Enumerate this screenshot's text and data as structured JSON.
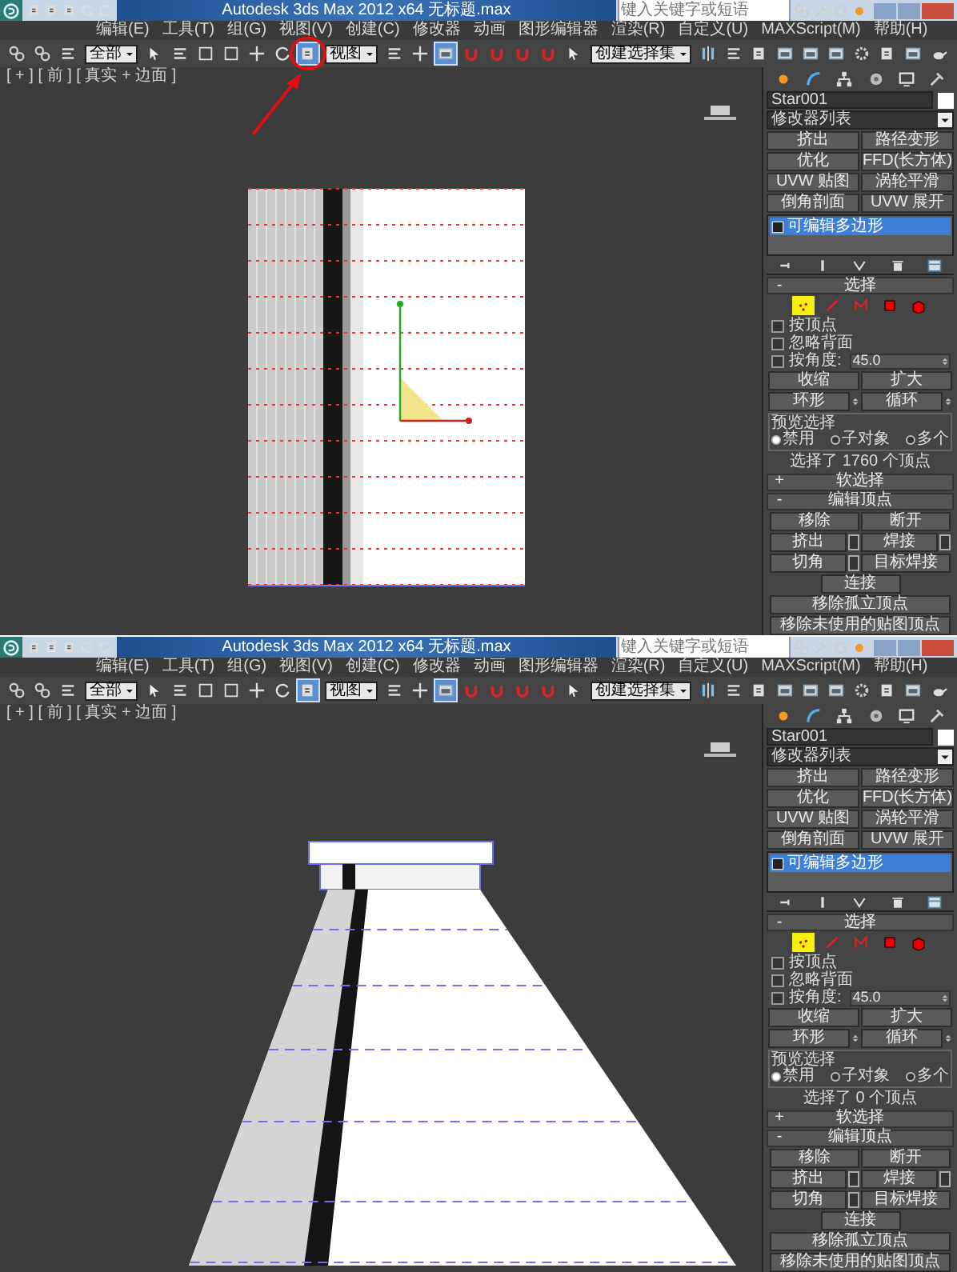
{
  "screenshots": [
    {
      "title_bar": {
        "title": "Autodesk 3ds Max  2012 x64    无标题.max",
        "search_placeholder": "键入关键字或短语"
      },
      "menu": [
        "编辑(E)",
        "工具(T)",
        "组(G)",
        "视图(V)",
        "创建(C)",
        "修改器",
        "动画",
        "图形编辑器",
        "渲染(R)",
        "自定义(U)",
        "MAXScript(M)",
        "帮助(H)"
      ],
      "toolbar": [
        {
          "kind": "button",
          "selected": false,
          "callout": false
        },
        {
          "kind": "button",
          "selected": false,
          "callout": false
        },
        {
          "kind": "button",
          "selected": false,
          "callout": false
        },
        {
          "kind": "dropdown",
          "value": "全部"
        },
        {
          "kind": "button",
          "selected": false,
          "callout": false
        },
        {
          "kind": "button",
          "selected": false,
          "callout": false
        },
        {
          "kind": "button",
          "selected": false,
          "callout": false
        },
        {
          "kind": "button",
          "selected": false,
          "callout": false
        },
        {
          "kind": "button",
          "selected": false,
          "callout": false
        },
        {
          "kind": "button",
          "selected": false,
          "callout": false
        },
        {
          "kind": "button",
          "selected": true,
          "callout": true
        },
        {
          "kind": "dropdown",
          "value": "视图"
        },
        {
          "kind": "button",
          "selected": false,
          "callout": false
        },
        {
          "kind": "button",
          "selected": false,
          "callout": false
        },
        {
          "kind": "button",
          "selected": true,
          "callout": false
        },
        {
          "kind": "button",
          "selected": false,
          "callout": false
        },
        {
          "kind": "button",
          "selected": false,
          "callout": false
        },
        {
          "kind": "button",
          "selected": false,
          "callout": false
        },
        {
          "kind": "button",
          "selected": false,
          "callout": false
        },
        {
          "kind": "button",
          "selected": false,
          "callout": false
        },
        {
          "kind": "dropdown",
          "value": "创建选择集"
        },
        {
          "kind": "button",
          "selected": false,
          "callout": false
        },
        {
          "kind": "button",
          "selected": false,
          "callout": false
        },
        {
          "kind": "button",
          "selected": false,
          "callout": false
        },
        {
          "kind": "button",
          "selected": false,
          "callout": false
        },
        {
          "kind": "button",
          "selected": false,
          "callout": false
        },
        {
          "kind": "button",
          "selected": false,
          "callout": false
        },
        {
          "kind": "button",
          "selected": false,
          "callout": false
        },
        {
          "kind": "button",
          "selected": false,
          "callout": false
        },
        {
          "kind": "button",
          "selected": false,
          "callout": false
        },
        {
          "kind": "button",
          "selected": false,
          "callout": false
        }
      ],
      "viewport": {
        "label": "[ + ] [ 前 ] [ 真实 + 边面 ]",
        "kind": "front"
      },
      "panel": {
        "object_name": "Star001",
        "modifier_list": "修改器列表",
        "modifier_buttons": [
          "挤出",
          "路径变形",
          "优化",
          "FFD(长方体)",
          "UVW 贴图",
          "涡轮平滑",
          "倒角剖面",
          "UVW 展开"
        ],
        "stack": [
          {
            "label": "可编辑多边形",
            "selected": true
          }
        ],
        "selection": {
          "sign": "-",
          "title": "选择",
          "subobjects": [
            {
              "selected": true
            },
            {
              "selected": false
            },
            {
              "selected": false
            },
            {
              "selected": false
            },
            {
              "selected": false
            }
          ],
          "checkboxes": [
            {
              "kind": "plain",
              "label": "按顶点",
              "checked": false
            },
            {
              "kind": "plain",
              "label": "忽略背面",
              "checked": false
            },
            {
              "kind": "angle",
              "label": "按角度:",
              "checked": false,
              "value": "45.0"
            }
          ],
          "buttons": [
            {
              "kind": "plain",
              "label": "收缩"
            },
            {
              "kind": "plain",
              "label": "扩大"
            },
            {
              "kind": "spinner",
              "label": "环形"
            },
            {
              "kind": "spinner",
              "label": "循环"
            }
          ],
          "preview": {
            "title": "预览选择",
            "options": [
              {
                "label": "禁用",
                "selected": true
              },
              {
                "label": "子对象",
                "selected": false
              },
              {
                "label": "多个",
                "selected": false
              }
            ]
          },
          "status": "选择了 1760 个顶点"
        },
        "soft_selection": {
          "sign": "+",
          "title": "软选择"
        },
        "edit_vertices": {
          "sign": "-",
          "title": "编辑顶点",
          "buttons": [
            {
              "kind": "half",
              "label": "移除"
            },
            {
              "kind": "half",
              "label": "断开"
            },
            {
              "kind": "settings",
              "label": "挤出"
            },
            {
              "kind": "settings",
              "label": "焊接"
            },
            {
              "kind": "settings",
              "label": "切角"
            },
            {
              "kind": "half",
              "label": "目标焊接"
            },
            {
              "kind": "center",
              "label": "连接"
            },
            {
              "kind": "full",
              "label": "移除孤立顶点"
            },
            {
              "kind": "full",
              "label": "移除未使用的贴图顶点"
            }
          ]
        }
      }
    },
    {
      "title_bar": {
        "title": "Autodesk 3ds Max  2012 x64    无标题.max",
        "search_placeholder": "键入关键字或短语"
      },
      "menu": [
        "编辑(E)",
        "工具(T)",
        "组(G)",
        "视图(V)",
        "创建(C)",
        "修改器",
        "动画",
        "图形编辑器",
        "渲染(R)",
        "自定义(U)",
        "MAXScript(M)",
        "帮助(H)"
      ],
      "toolbar": [
        {
          "kind": "button",
          "selected": false,
          "callout": false
        },
        {
          "kind": "button",
          "selected": false,
          "callout": false
        },
        {
          "kind": "button",
          "selected": false,
          "callout": false
        },
        {
          "kind": "dropdown",
          "value": "全部"
        },
        {
          "kind": "button",
          "selected": false,
          "callout": false
        },
        {
          "kind": "button",
          "selected": false,
          "callout": false
        },
        {
          "kind": "button",
          "selected": false,
          "callout": false
        },
        {
          "kind": "button",
          "selected": false,
          "callout": false
        },
        {
          "kind": "button",
          "selected": false,
          "callout": false
        },
        {
          "kind": "button",
          "selected": false,
          "callout": false
        },
        {
          "kind": "button",
          "selected": true,
          "callout": false
        },
        {
          "kind": "dropdown",
          "value": "视图"
        },
        {
          "kind": "button",
          "selected": false,
          "callout": false
        },
        {
          "kind": "button",
          "selected": false,
          "callout": false
        },
        {
          "kind": "button",
          "selected": true,
          "callout": false
        },
        {
          "kind": "button",
          "selected": false,
          "callout": false
        },
        {
          "kind": "button",
          "selected": false,
          "callout": false
        },
        {
          "kind": "button",
          "selected": false,
          "callout": false
        },
        {
          "kind": "button",
          "selected": false,
          "callout": false
        },
        {
          "kind": "button",
          "selected": false,
          "callout": false
        },
        {
          "kind": "dropdown",
          "value": "创建选择集"
        },
        {
          "kind": "button",
          "selected": false,
          "callout": false
        },
        {
          "kind": "button",
          "selected": false,
          "callout": false
        },
        {
          "kind": "button",
          "selected": false,
          "callout": false
        },
        {
          "kind": "button",
          "selected": false,
          "callout": false
        },
        {
          "kind": "button",
          "selected": false,
          "callout": false
        },
        {
          "kind": "button",
          "selected": false,
          "callout": false
        },
        {
          "kind": "button",
          "selected": false,
          "callout": false
        },
        {
          "kind": "button",
          "selected": false,
          "callout": false
        },
        {
          "kind": "button",
          "selected": false,
          "callout": false
        },
        {
          "kind": "button",
          "selected": false,
          "callout": false
        }
      ],
      "viewport": {
        "label": "[ + ] [ 前 ] [ 真实 + 边面 ]",
        "kind": "perspective"
      },
      "panel": {
        "object_name": "Star001",
        "modifier_list": "修改器列表",
        "modifier_buttons": [
          "挤出",
          "路径变形",
          "优化",
          "FFD(长方体)",
          "UVW 贴图",
          "涡轮平滑",
          "倒角剖面",
          "UVW 展开"
        ],
        "stack": [
          {
            "label": "可编辑多边形",
            "selected": true
          }
        ],
        "selection": {
          "sign": "-",
          "title": "选择",
          "subobjects": [
            {
              "selected": true
            },
            {
              "selected": false
            },
            {
              "selected": false
            },
            {
              "selected": false
            },
            {
              "selected": false
            }
          ],
          "checkboxes": [
            {
              "kind": "plain",
              "label": "按顶点",
              "checked": false
            },
            {
              "kind": "plain",
              "label": "忽略背面",
              "checked": false
            },
            {
              "kind": "angle",
              "label": "按角度:",
              "checked": false,
              "value": "45.0"
            }
          ],
          "buttons": [
            {
              "kind": "plain",
              "label": "收缩"
            },
            {
              "kind": "plain",
              "label": "扩大"
            },
            {
              "kind": "spinner",
              "label": "环形"
            },
            {
              "kind": "spinner",
              "label": "循环"
            }
          ],
          "preview": {
            "title": "预览选择",
            "options": [
              {
                "label": "禁用",
                "selected": true
              },
              {
                "label": "子对象",
                "selected": false
              },
              {
                "label": "多个",
                "selected": false
              }
            ]
          },
          "status": "选择了 0 个顶点"
        },
        "soft_selection": {
          "sign": "+",
          "title": "软选择"
        },
        "edit_vertices": {
          "sign": "-",
          "title": "编辑顶点",
          "buttons": [
            {
              "kind": "half",
              "label": "移除"
            },
            {
              "kind": "half",
              "label": "断开"
            },
            {
              "kind": "settings",
              "label": "挤出"
            },
            {
              "kind": "settings",
              "label": "焊接"
            },
            {
              "kind": "settings",
              "label": "切角"
            },
            {
              "kind": "half",
              "label": "目标焊接"
            },
            {
              "kind": "center",
              "label": "连接"
            },
            {
              "kind": "full",
              "label": "移除孤立顶点"
            },
            {
              "kind": "full",
              "label": "移除未使用的贴图顶点"
            }
          ]
        }
      }
    }
  ]
}
